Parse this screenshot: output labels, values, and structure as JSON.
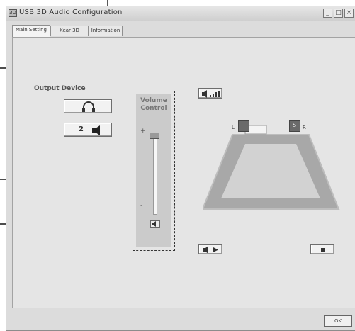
{
  "window": {
    "title": "USB 3D Audio Configuration",
    "app_icon_text": "3D"
  },
  "tabs": [
    {
      "label": "Main Setting",
      "active": true
    },
    {
      "label": "Xear 3D",
      "active": false
    },
    {
      "label": "Information",
      "active": false
    }
  ],
  "output_device": {
    "label": "Output Device",
    "headphone_icon": "headphone-icon",
    "speaker_count": "2",
    "speaker_icon": "speaker-icon"
  },
  "volume_control": {
    "label_line1": "Volume",
    "label_line2": "Control",
    "plus_mark": "+",
    "minus_mark": "-",
    "level": 1.0
  },
  "speakers": {
    "left_label": "L",
    "right_label": "R",
    "right_square_label": "S"
  },
  "footer": {
    "ok_label": "OK"
  },
  "colors": {
    "window_bg": "#dcdcdc",
    "panel_bg": "#e5e5e5",
    "stage_fill": "#a8a8a8",
    "speaker_square": "#6a6a6a"
  }
}
